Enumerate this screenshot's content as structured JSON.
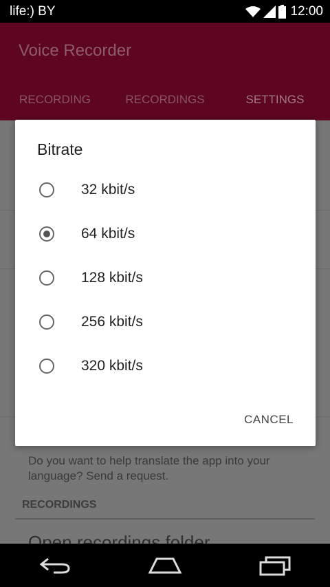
{
  "status_bar": {
    "carrier": "life:) BY",
    "time": "12:00"
  },
  "app_bar": {
    "title": "Voice Recorder",
    "tabs": [
      {
        "label": "RECORDING"
      },
      {
        "label": "RECORDINGS"
      },
      {
        "label": "SETTINGS",
        "active": true
      }
    ]
  },
  "background": {
    "description": "Do you want to help translate the app into your language? Send a request.",
    "section_header": "RECORDINGS",
    "item": "Open recordings folder"
  },
  "dialog": {
    "title": "Bitrate",
    "options": [
      {
        "label": "32 kbit/s",
        "selected": false
      },
      {
        "label": "64 kbit/s",
        "selected": true
      },
      {
        "label": "128 kbit/s",
        "selected": false
      },
      {
        "label": "256 kbit/s",
        "selected": false
      },
      {
        "label": "320 kbit/s",
        "selected": false
      }
    ],
    "cancel_label": "CANCEL"
  },
  "colors": {
    "primary": "#5e0620",
    "dialog_bg": "#ffffff"
  }
}
